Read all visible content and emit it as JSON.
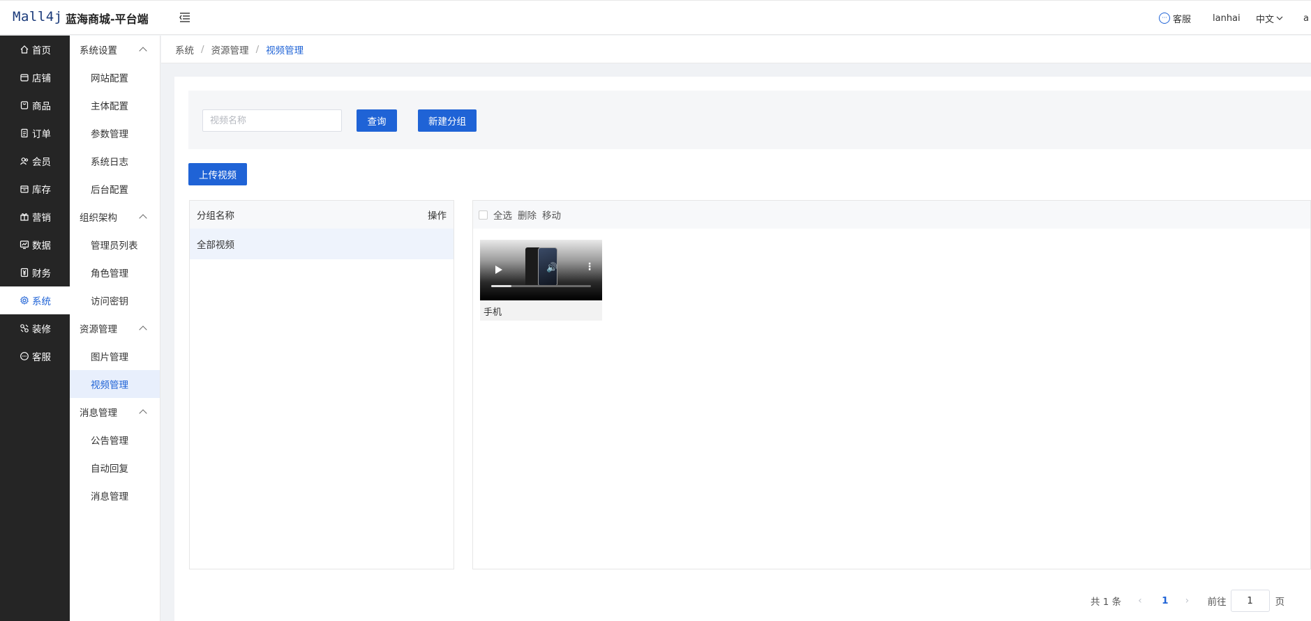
{
  "header": {
    "logo": "Mall4j",
    "brand": "蓝海商城-平台端",
    "customer_service": "客服",
    "username": "lanhai",
    "language": "中文",
    "extra": "a"
  },
  "nav1": {
    "items": [
      {
        "label": "首页",
        "icon": "home-icon"
      },
      {
        "label": "店铺",
        "icon": "store-icon"
      },
      {
        "label": "商品",
        "icon": "goods-icon"
      },
      {
        "label": "订单",
        "icon": "order-icon"
      },
      {
        "label": "会员",
        "icon": "member-icon"
      },
      {
        "label": "库存",
        "icon": "inventory-icon"
      },
      {
        "label": "营销",
        "icon": "gift-icon"
      },
      {
        "label": "数据",
        "icon": "chart-icon"
      },
      {
        "label": "财务",
        "icon": "finance-icon"
      },
      {
        "label": "系统",
        "icon": "gear-icon"
      },
      {
        "label": "装修",
        "icon": "decorate-icon"
      },
      {
        "label": "客服",
        "icon": "chat-icon"
      }
    ],
    "active_index": 9
  },
  "nav2": {
    "groups": [
      {
        "title": "系统设置",
        "items": [
          "网站配置",
          "主体配置",
          "参数管理",
          "系统日志",
          "后台配置"
        ]
      },
      {
        "title": "组织架构",
        "items": [
          "管理员列表",
          "角色管理",
          "访问密钥"
        ]
      },
      {
        "title": "资源管理",
        "items": [
          "图片管理",
          "视频管理"
        ]
      },
      {
        "title": "消息管理",
        "items": [
          "公告管理",
          "自动回复",
          "消息管理"
        ]
      }
    ],
    "active_item": "视频管理"
  },
  "breadcrumb": [
    "系统",
    "资源管理",
    "视频管理"
  ],
  "search": {
    "placeholder": "视频名称",
    "value": "",
    "query_button": "查询",
    "new_group_button": "新建分组"
  },
  "upload_button": "上传视频",
  "group_table": {
    "col_name": "分组名称",
    "col_action": "操作",
    "rows": [
      "全部视频"
    ]
  },
  "video_toolbar": {
    "select_all": "全选",
    "delete": "删除",
    "move": "移动"
  },
  "videos": [
    {
      "name": "手机",
      "progress": 0.2
    }
  ],
  "pagination": {
    "total_text": "共 1 条",
    "current_page": "1",
    "goto_label": "前往",
    "goto_value": "1",
    "page_suffix": "页"
  },
  "colors": {
    "primary": "#1f63d6",
    "sidebar_bg": "#252525"
  }
}
